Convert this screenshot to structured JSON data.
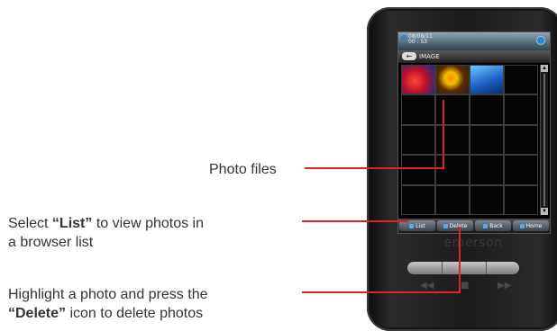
{
  "callouts": {
    "photo_files": "Photo files",
    "select_list": {
      "prefix": "Select ",
      "bold": "“List”",
      "suffix": " to view photos in",
      "line2": "a browser list"
    },
    "delete": {
      "line1": "Highlight a photo and press the",
      "bold": "“Delete”",
      "suffix": " icon to delete photos"
    }
  },
  "device": {
    "status": {
      "date": "08/08/11",
      "time": "00 : 53"
    },
    "title": "IMAGE",
    "back_label": "←",
    "softkeys": [
      "List",
      "Delete",
      "Back",
      "Home"
    ],
    "brand": "emerson",
    "controls": {
      "prev": "◀◀",
      "play": "■",
      "next": "▶▶"
    },
    "scroll_up": "▲",
    "scroll_down": "▼"
  },
  "colors": {
    "leader": "#d7242f"
  }
}
